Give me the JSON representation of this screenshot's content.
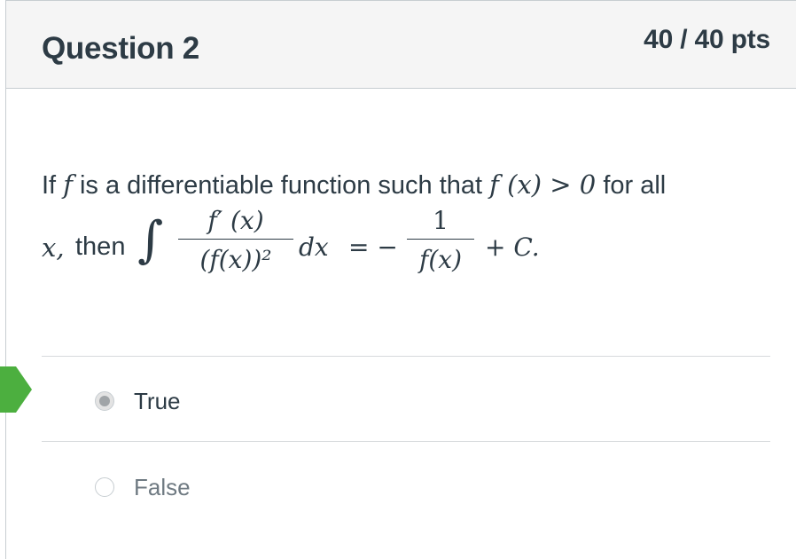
{
  "question": {
    "title": "Question 2",
    "points": "40 / 40 pts",
    "text_line1_prefix": "If",
    "text_f": "f",
    "text_line1_mid": "is a differentiable function such that",
    "text_fx_gt_0": "f (x) > 0",
    "text_line1_suffix": "for all",
    "text_x": "x,",
    "text_then": "then",
    "integral_sign": "∫",
    "integrand_numerator": "f′ (x)",
    "integrand_denominator": "(f(x))²",
    "dx": "dx",
    "equals_minus": "= −",
    "rhs_numerator": "1",
    "rhs_denominator": "f(x)",
    "plus_c": "+ C."
  },
  "answers": [
    {
      "label": "True",
      "selected": true,
      "correct_marker": true
    },
    {
      "label": "False",
      "selected": false,
      "correct_marker": false
    }
  ],
  "colors": {
    "correct_arrow": "#4caf3f",
    "header_bg": "#f5f5f5",
    "text": "#2d3b45"
  },
  "icons": {
    "correct_answer_marker": "correct-answer-arrow-icon"
  }
}
